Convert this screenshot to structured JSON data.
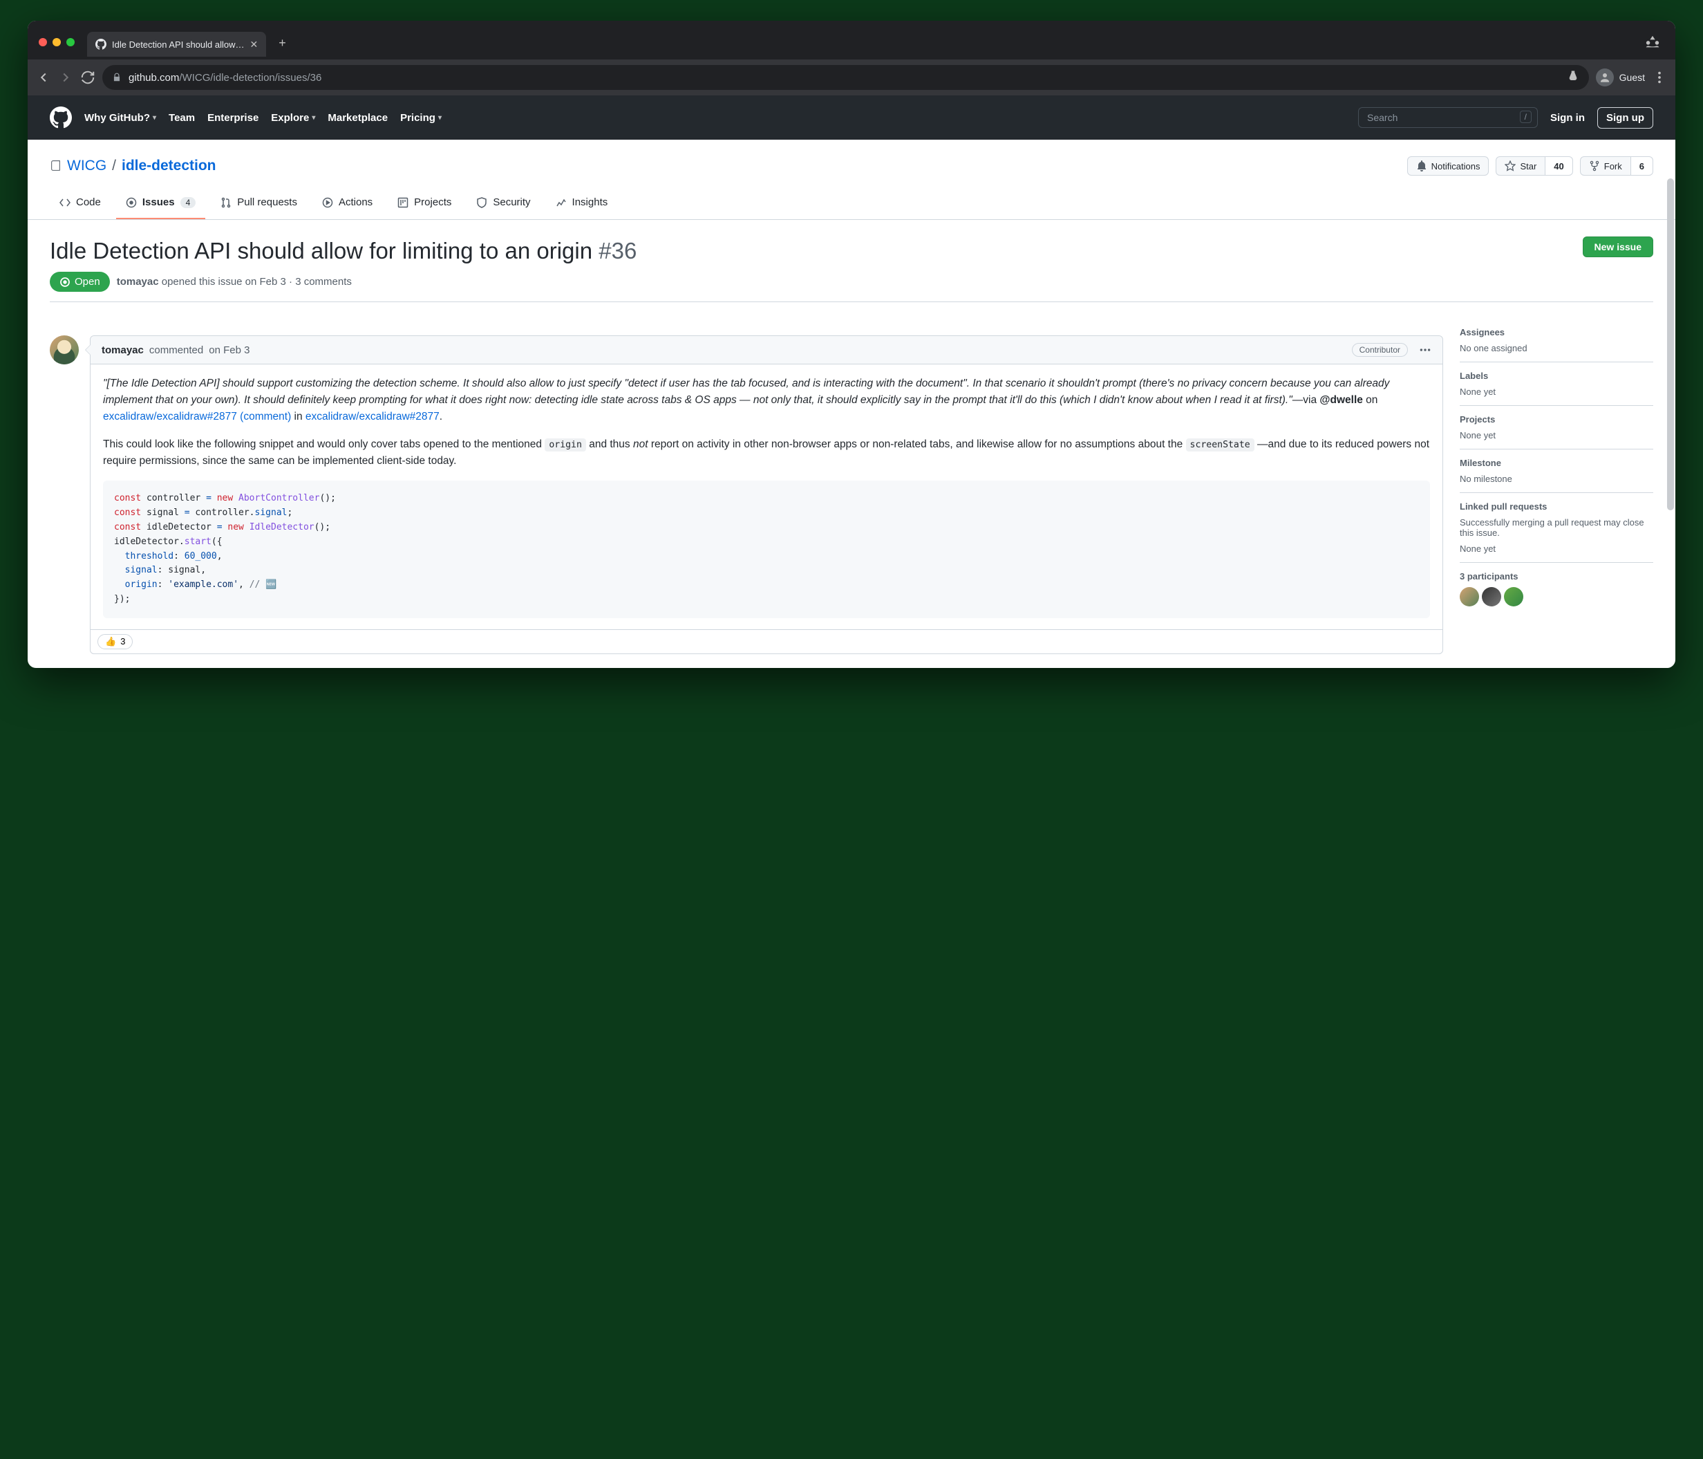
{
  "browser": {
    "tab_title": "Idle Detection API should allow…",
    "url_domain": "github.com",
    "url_path": "/WICG/idle-detection/issues/36",
    "guest_label": "Guest"
  },
  "gh_nav": {
    "why": "Why GitHub?",
    "team": "Team",
    "enterprise": "Enterprise",
    "explore": "Explore",
    "marketplace": "Marketplace",
    "pricing": "Pricing",
    "search_placeholder": "Search",
    "slash": "/",
    "signin": "Sign in",
    "signup": "Sign up"
  },
  "repo": {
    "owner": "WICG",
    "name": "idle-detection",
    "notifications": "Notifications",
    "star": "Star",
    "star_count": "40",
    "fork": "Fork",
    "fork_count": "6"
  },
  "tabs": {
    "code": "Code",
    "issues": "Issues",
    "issues_count": "4",
    "prs": "Pull requests",
    "actions": "Actions",
    "projects": "Projects",
    "security": "Security",
    "insights": "Insights"
  },
  "issue": {
    "title": "Idle Detection API should allow for limiting to an origin",
    "number": "#36",
    "new_issue": "New issue",
    "state": "Open",
    "author": "tomayac",
    "opened_text": "opened this issue on Feb 3 · 3 comments"
  },
  "comment": {
    "author": "tomayac",
    "verb": "commented",
    "date": "on Feb 3",
    "badge": "Contributor",
    "quote": "\"[The Idle Detection API] should support customizing the detection scheme. It should also allow to just specify \"detect if user has the tab focused, and is interacting with the document\". In that scenario it shouldn't prompt (there's no privacy concern because you can already implement that on your own). It should definitely keep prompting for what it does right now: detecting idle state across tabs & OS apps — not only that, it should explicitly say in the prompt that it'll do this (which I didn't know about when I read it at first).\"",
    "via": "—via ",
    "mention": "@dwelle",
    "on": " on ",
    "link1": "excalidraw/excalidraw#2877 (comment)",
    "in": " in ",
    "link2": "excalidraw/excalidraw#2877",
    "para2_a": "This could look like the following snippet and would only cover tabs opened to the mentioned ",
    "code1": "origin",
    "para2_b": " and thus ",
    "not": "not",
    "para2_c": " report on activity in other non-browser apps or non-related tabs, and likewise allow for no assumptions about the ",
    "code2": "screenState",
    "para2_d": " —and due to its reduced powers not require permissions, since the same can be implemented client-side today.",
    "reaction_emoji": "👍",
    "reaction_count": "3"
  },
  "code": {
    "l1a": "const",
    "l1b": " controller ",
    "l1c": "=",
    "l1d": " new ",
    "l1e": "AbortController",
    "l1f": "();",
    "l2a": "const",
    "l2b": " signal ",
    "l2c": "=",
    "l2d": " controller.",
    "l2e": "signal",
    "l2f": ";",
    "l3a": "const",
    "l3b": " idleDetector ",
    "l3c": "=",
    "l3d": " new ",
    "l3e": "IdleDetector",
    "l3f": "();",
    "l4a": "idleDetector.",
    "l4b": "start",
    "l4c": "({",
    "l5a": "  threshold",
    "l5b": ": ",
    "l5c": "60_000",
    "l5d": ",",
    "l6a": "  signal",
    "l6b": ": signal,",
    "l7a": "  origin",
    "l7b": ": ",
    "l7c": "'example.com'",
    "l7d": ", ",
    "l7e": "// 🆕",
    "l8": "});"
  },
  "sidebar": {
    "assignees_h": "Assignees",
    "assignees_v": "No one assigned",
    "labels_h": "Labels",
    "labels_v": "None yet",
    "projects_h": "Projects",
    "projects_v": "None yet",
    "milestone_h": "Milestone",
    "milestone_v": "No milestone",
    "linked_h": "Linked pull requests",
    "linked_desc": "Successfully merging a pull request may close this issue.",
    "linked_v": "None yet",
    "participants_h": "3 participants"
  }
}
